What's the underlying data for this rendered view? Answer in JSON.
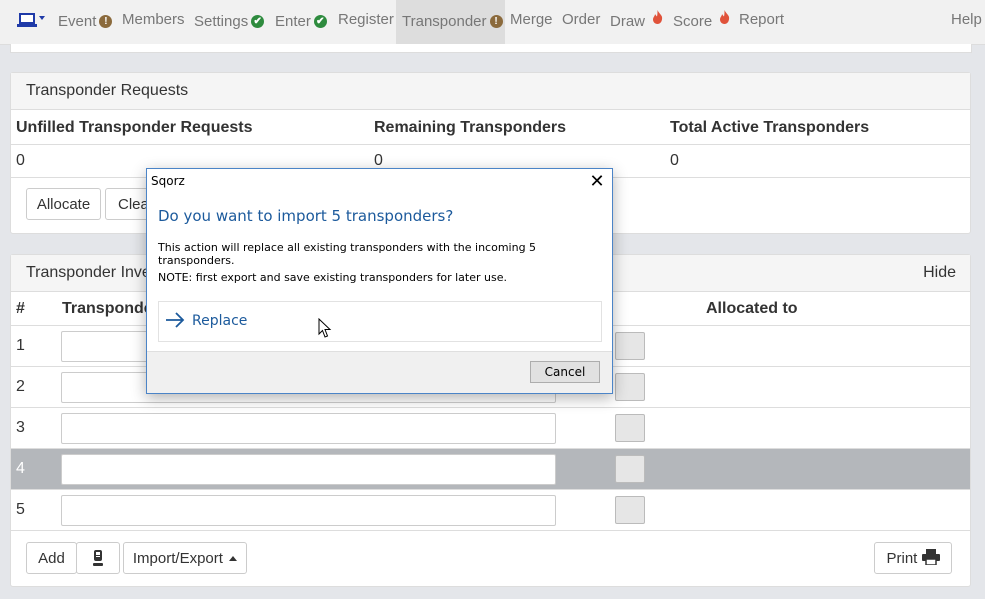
{
  "nav": {
    "items": [
      {
        "label": "Event",
        "status": "warn"
      },
      {
        "label": "Members"
      },
      {
        "label": "Settings",
        "status": "ok"
      },
      {
        "label": "Enter",
        "status": "ok"
      },
      {
        "label": "Register"
      },
      {
        "label": "Transponder",
        "status": "warn",
        "active": true
      },
      {
        "label": "Merge"
      },
      {
        "label": "Order"
      },
      {
        "label": "Draw",
        "status": "fire"
      },
      {
        "label": "Score",
        "status": "fire"
      },
      {
        "label": "Report"
      }
    ],
    "help": "Help",
    "badge_warn": "!",
    "badge_ok": "✔"
  },
  "requests": {
    "title": "Transponder Requests",
    "headers": [
      "Unfilled Transponder Requests",
      "Remaining Transponders",
      "Total Active Transponders"
    ],
    "values": [
      "0",
      "0",
      "0"
    ],
    "allocate_label": "Allocate",
    "clear_label": "Clea"
  },
  "inventory": {
    "title": "Transponder Inve",
    "hide_label": "Hide",
    "headers": {
      "num": "#",
      "transponder": "Transponde",
      "allocated": "Allocated to"
    },
    "rows": [
      {
        "num": "1",
        "value": ""
      },
      {
        "num": "2",
        "value": ""
      },
      {
        "num": "3",
        "value": ""
      },
      {
        "num": "4",
        "value": ""
      },
      {
        "num": "5",
        "value": ""
      }
    ],
    "selected_row": "4",
    "add_label": "Add",
    "import_export_label": "Import/Export",
    "print_label": "Print"
  },
  "dialog": {
    "title": "Sqorz",
    "heading": "Do you want to import 5 transponders?",
    "text1": "This action will replace all existing transponders with the incoming 5 transponders.",
    "text2": "NOTE: first export and save existing transponders for later use.",
    "option_label": "Replace",
    "cancel_label": "Cancel"
  },
  "colors": {
    "accent": "#1c5a9c",
    "warn": "#8b6a3c",
    "ok": "#2e8b3e",
    "fire": "#e0523a",
    "selected_row": "#b4b7bb"
  }
}
